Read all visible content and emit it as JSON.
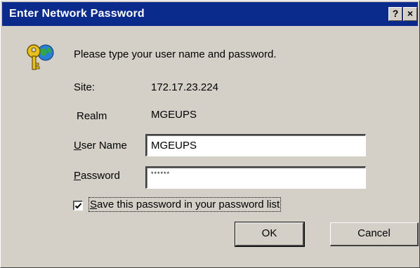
{
  "window": {
    "title": "Enter Network Password",
    "help_button": "?",
    "close_button": "×"
  },
  "prompt": "Please type your user name and password.",
  "site": {
    "label": "Site:",
    "value": "172.17.23.224"
  },
  "realm": {
    "label": "Realm",
    "value": "MGEUPS"
  },
  "username": {
    "label_accel": "U",
    "label_rest": "ser Name",
    "value": "MGEUPS"
  },
  "password": {
    "label_accel": "P",
    "label_rest": "assword",
    "masked_value": "******"
  },
  "save_password": {
    "label_accel": "S",
    "label_rest": "ave this password in your password list",
    "checked": true
  },
  "buttons": {
    "ok": "OK",
    "cancel": "Cancel"
  },
  "colors": {
    "titlebar": "#0a2a8c",
    "dialog_bg": "#d4d0c8"
  },
  "icons": [
    "key-icon",
    "check-icon"
  ]
}
